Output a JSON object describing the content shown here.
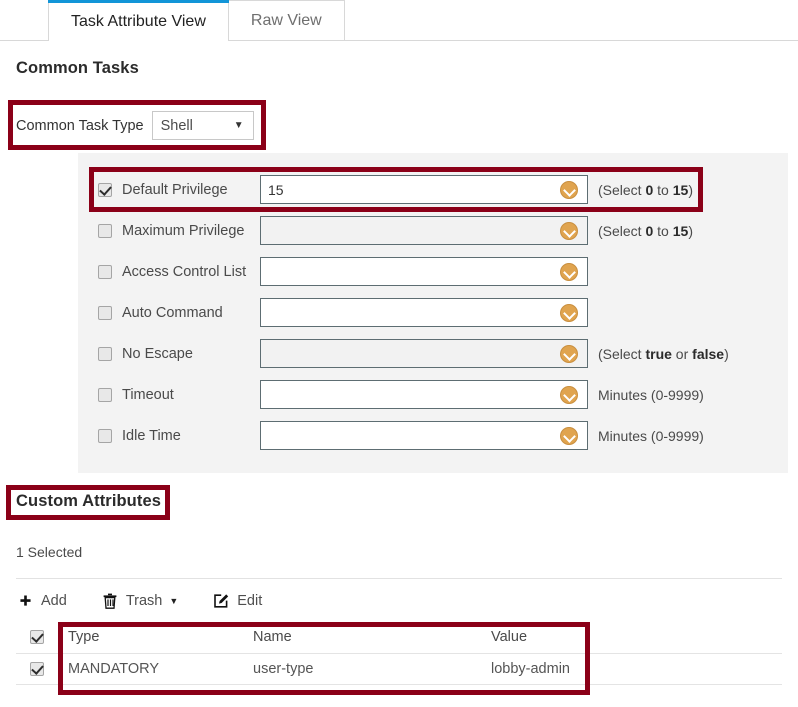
{
  "tabs": [
    {
      "label": "Task Attribute View",
      "active": true
    },
    {
      "label": "Raw View",
      "active": false
    }
  ],
  "common_tasks": {
    "title": "Common Tasks",
    "task_type": {
      "label": "Common Task Type",
      "value": "Shell",
      "caret_icon": "chevron-down-icon"
    },
    "fields": [
      {
        "label": "Default Privilege",
        "checked": true,
        "value": "15",
        "disabled": false,
        "hint_prefix": "(Select ",
        "hint_bold1": "0",
        "hint_mid": " to ",
        "hint_bold2": "15",
        "hint_suffix": ")"
      },
      {
        "label": "Maximum Privilege",
        "checked": false,
        "value": "",
        "disabled": true,
        "hint_prefix": "(Select ",
        "hint_bold1": "0",
        "hint_mid": " to ",
        "hint_bold2": "15",
        "hint_suffix": ")"
      },
      {
        "label": "Access Control List",
        "checked": false,
        "value": "",
        "disabled": false,
        "hint_prefix": "",
        "hint_bold1": "",
        "hint_mid": "",
        "hint_bold2": "",
        "hint_suffix": ""
      },
      {
        "label": "Auto Command",
        "checked": false,
        "value": "",
        "disabled": false,
        "hint_prefix": "",
        "hint_bold1": "",
        "hint_mid": "",
        "hint_bold2": "",
        "hint_suffix": ""
      },
      {
        "label": "No Escape",
        "checked": false,
        "value": "",
        "disabled": true,
        "hint_prefix": "(Select ",
        "hint_bold1": "true",
        "hint_mid": " or ",
        "hint_bold2": "false",
        "hint_suffix": ")"
      },
      {
        "label": "Timeout",
        "checked": false,
        "value": "",
        "disabled": false,
        "hint_prefix": "Minutes (0-9999)",
        "hint_bold1": "",
        "hint_mid": "",
        "hint_bold2": "",
        "hint_suffix": ""
      },
      {
        "label": "Idle Time",
        "checked": false,
        "value": "",
        "disabled": false,
        "hint_prefix": "Minutes (0-9999)",
        "hint_bold1": "",
        "hint_mid": "",
        "hint_bold2": "",
        "hint_suffix": ""
      }
    ]
  },
  "custom_attributes": {
    "title": "Custom Attributes",
    "selected_text": "1 Selected",
    "toolbar": [
      {
        "label": "Add",
        "icon": "plus-icon",
        "has_caret": false
      },
      {
        "label": "Trash",
        "icon": "trash-icon",
        "has_caret": true
      },
      {
        "label": "Edit",
        "icon": "pencil-square-icon",
        "has_caret": false
      }
    ],
    "table": {
      "columns": [
        "Type",
        "Name",
        "Value"
      ],
      "header_checked": true,
      "rows": [
        {
          "checked": true,
          "type": "MANDATORY",
          "name": "user-type",
          "value": "lobby-admin"
        }
      ]
    }
  },
  "colors": {
    "active_tab_accent": "#1295d8",
    "highlight_box": "#8b0018",
    "panel_bg": "#f3f3f3",
    "chevron_button": "#e0a44f"
  }
}
